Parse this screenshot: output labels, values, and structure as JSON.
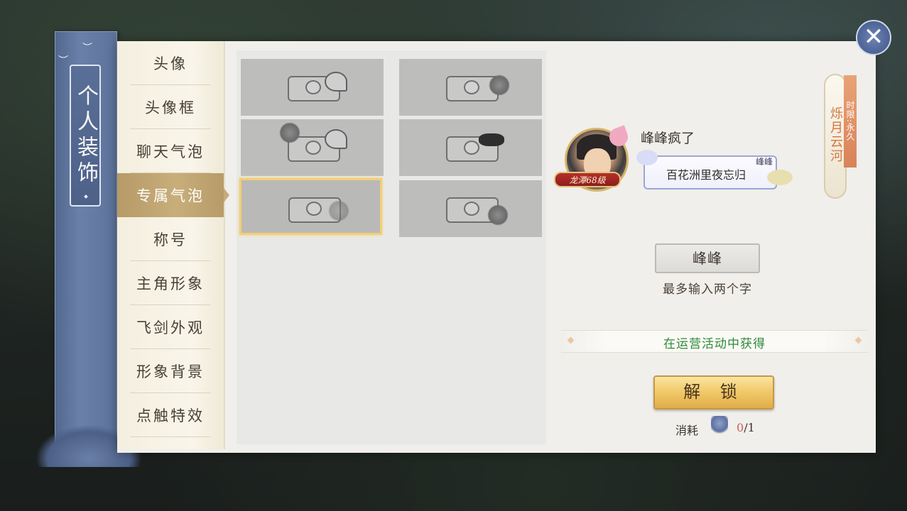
{
  "page_title": "个人装饰",
  "menu": {
    "items": [
      {
        "label": "头像"
      },
      {
        "label": "头像框"
      },
      {
        "label": "聊天气泡"
      },
      {
        "label": "专属气泡"
      },
      {
        "label": "称号"
      },
      {
        "label": "主角形象"
      },
      {
        "label": "飞剑外观"
      },
      {
        "label": "形象背景"
      },
      {
        "label": "点触特效"
      }
    ],
    "active_index": 3
  },
  "preview": {
    "chip_tag": "时限:永久",
    "chip_name": "烁月云河",
    "level_badge": "龙潭68级",
    "player_name": "峰峰疯了",
    "bubble_text": "百花洲里夜忘归",
    "bubble_tag": "峰峰",
    "name_input_value": "峰峰",
    "name_input_hint": "最多输入两个字",
    "source_text": "在运营活动中获得",
    "unlock_label": "解 锁",
    "cost_label": "消耗",
    "cost_have": "0",
    "cost_need": "/1"
  },
  "close_label": "✕",
  "colors": {
    "active_menu": "#c2a673",
    "source_text": "#2f8a3a",
    "unlock_button": "#f0c867",
    "selected_border": "#f3cf73"
  }
}
